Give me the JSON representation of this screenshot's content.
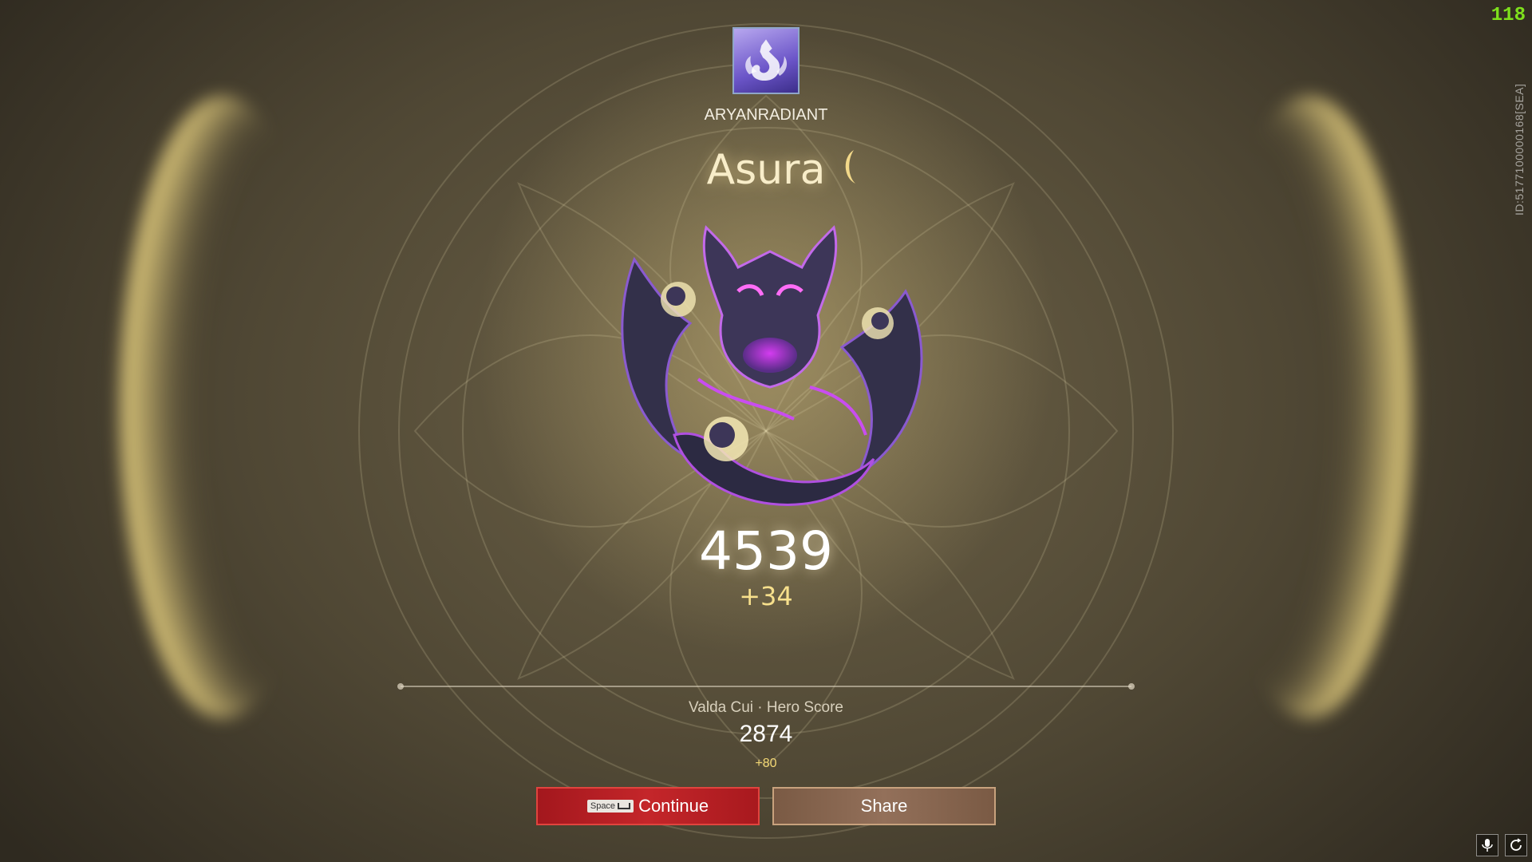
{
  "hud": {
    "fps": "118",
    "server_id": "ID:51771000001­68[SEA]"
  },
  "player": {
    "name": "ARYANRADIANT",
    "avatar_icon": "fox-spirit-icon"
  },
  "rank": {
    "tier_name": "Asura",
    "emblem_icon": "asura-dragon-emblem-icon",
    "score": "4539",
    "score_change": "+34"
  },
  "hero": {
    "label": "Valda Cui · Hero Score",
    "score": "2874",
    "score_change": "+80"
  },
  "buttons": {
    "continue_key": "Space",
    "continue_label": "Continue",
    "share_label": "Share"
  },
  "colors": {
    "accent_red": "#c4262a",
    "accent_brown": "#93705a",
    "gold": "#f7e08c",
    "fps_green": "#7ee01c"
  }
}
